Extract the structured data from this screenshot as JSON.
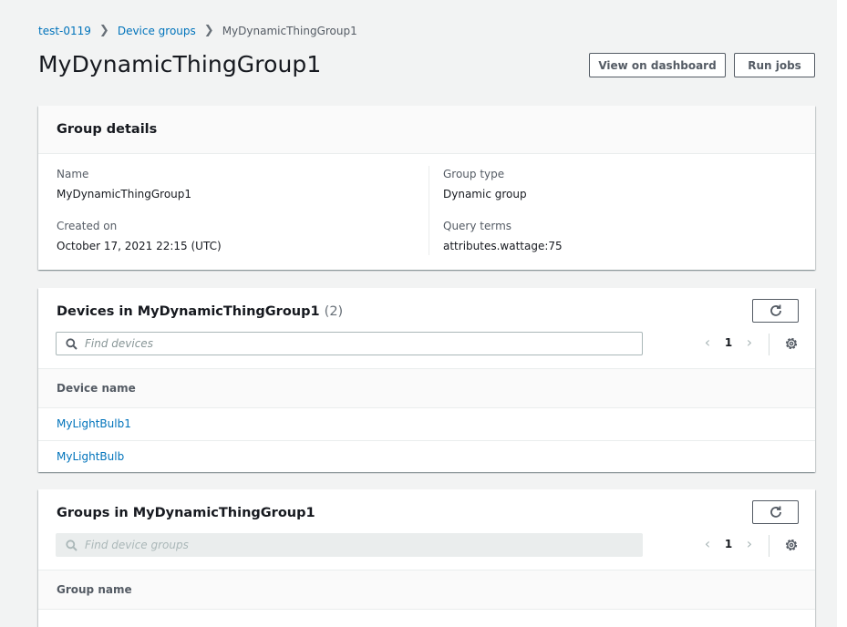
{
  "breadcrumb": {
    "items": [
      "test-0119",
      "Device groups"
    ],
    "current": "MyDynamicThingGroup1"
  },
  "page": {
    "title": "MyDynamicThingGroup1",
    "view_dashboard_label": "View on dashboard",
    "run_jobs_label": "Run jobs"
  },
  "details": {
    "title": "Group details",
    "name_label": "Name",
    "name_value": "MyDynamicThingGroup1",
    "created_label": "Created on",
    "created_value": "October 17, 2021 22:15 (UTC)",
    "type_label": "Group type",
    "type_value": "Dynamic group",
    "query_label": "Query terms",
    "query_value": "attributes.wattage:75"
  },
  "devices": {
    "title": "Devices in MyDynamicThingGroup1",
    "count": "(2)",
    "search_placeholder": "Find devices",
    "page": "1",
    "column": "Device name",
    "rows": [
      "MyLightBulb1",
      "MyLightBulb"
    ]
  },
  "groups": {
    "title": "Groups in MyDynamicThingGroup1",
    "search_placeholder": "Find device groups",
    "page": "1",
    "column": "Group name"
  },
  "icons": {
    "refresh": "refresh-icon",
    "search": "search-icon",
    "settings": "gear-icon",
    "prev": "chevron-left-icon",
    "next": "chevron-right-icon"
  },
  "colors": {
    "link": "#0073bb",
    "background": "#f2f3f3",
    "text": "#16191f"
  }
}
